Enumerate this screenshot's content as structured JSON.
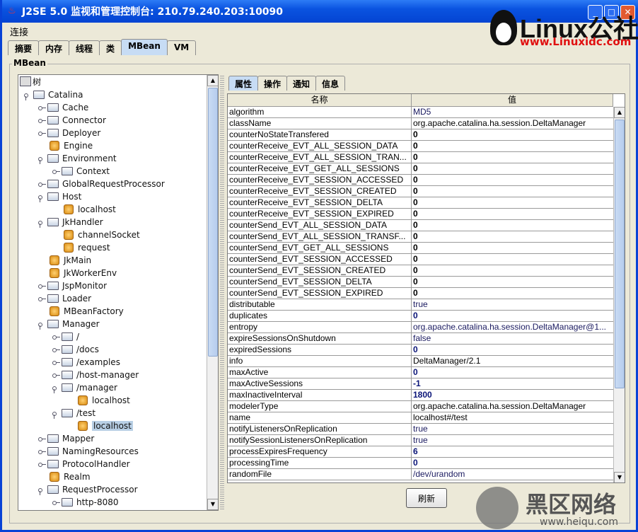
{
  "window": {
    "title": "J2SE 5.0 监视和管理控制台: 210.79.240.203:10090"
  },
  "menu": [
    "连接"
  ],
  "tabs": [
    {
      "label": "摘要"
    },
    {
      "label": "内存"
    },
    {
      "label": "线程"
    },
    {
      "label": "类"
    },
    {
      "label": "MBean",
      "active": true
    },
    {
      "label": "VM"
    }
  ],
  "group_label": "MBean",
  "tree": {
    "root": "树",
    "nodes": [
      {
        "label": "Catalina",
        "depth": 0,
        "type": "folder",
        "expanded": true
      },
      {
        "label": "Cache",
        "depth": 1,
        "type": "folder"
      },
      {
        "label": "Connector",
        "depth": 1,
        "type": "folder"
      },
      {
        "label": "Deployer",
        "depth": 1,
        "type": "folder"
      },
      {
        "label": "Engine",
        "depth": 1,
        "type": "bean"
      },
      {
        "label": "Environment",
        "depth": 1,
        "type": "folder",
        "expanded": true
      },
      {
        "label": "Context",
        "depth": 2,
        "type": "folder"
      },
      {
        "label": "GlobalRequestProcessor",
        "depth": 1,
        "type": "folder"
      },
      {
        "label": "Host",
        "depth": 1,
        "type": "folder",
        "expanded": true
      },
      {
        "label": "localhost",
        "depth": 2,
        "type": "bean"
      },
      {
        "label": "JkHandler",
        "depth": 1,
        "type": "folder",
        "expanded": true
      },
      {
        "label": "channelSocket",
        "depth": 2,
        "type": "bean"
      },
      {
        "label": "request",
        "depth": 2,
        "type": "bean"
      },
      {
        "label": "JkMain",
        "depth": 1,
        "type": "bean"
      },
      {
        "label": "JkWorkerEnv",
        "depth": 1,
        "type": "bean"
      },
      {
        "label": "JspMonitor",
        "depth": 1,
        "type": "folder"
      },
      {
        "label": "Loader",
        "depth": 1,
        "type": "folder"
      },
      {
        "label": "MBeanFactory",
        "depth": 1,
        "type": "bean"
      },
      {
        "label": "Manager",
        "depth": 1,
        "type": "folder",
        "expanded": true
      },
      {
        "label": "/",
        "depth": 2,
        "type": "folder"
      },
      {
        "label": "/docs",
        "depth": 2,
        "type": "folder"
      },
      {
        "label": "/examples",
        "depth": 2,
        "type": "folder"
      },
      {
        "label": "/host-manager",
        "depth": 2,
        "type": "folder"
      },
      {
        "label": "/manager",
        "depth": 2,
        "type": "folder",
        "expanded": true
      },
      {
        "label": "localhost",
        "depth": 3,
        "type": "bean"
      },
      {
        "label": "/test",
        "depth": 2,
        "type": "folder",
        "expanded": true
      },
      {
        "label": "localhost",
        "depth": 3,
        "type": "bean",
        "selected": true
      },
      {
        "label": "Mapper",
        "depth": 1,
        "type": "folder"
      },
      {
        "label": "NamingResources",
        "depth": 1,
        "type": "folder"
      },
      {
        "label": "ProtocolHandler",
        "depth": 1,
        "type": "folder"
      },
      {
        "label": "Realm",
        "depth": 1,
        "type": "bean"
      },
      {
        "label": "RequestProcessor",
        "depth": 1,
        "type": "folder",
        "expanded": true
      },
      {
        "label": "http-8080",
        "depth": 2,
        "type": "folder"
      }
    ]
  },
  "detail_tabs": [
    {
      "label": "属性",
      "active": true
    },
    {
      "label": "操作"
    },
    {
      "label": "通知"
    },
    {
      "label": "信息"
    }
  ],
  "table": {
    "headers": [
      "名称",
      "值"
    ],
    "rows": [
      {
        "name": "algorithm",
        "value": "MD5",
        "style": "edit"
      },
      {
        "name": "className",
        "value": "org.apache.catalina.ha.session.DeltaManager",
        "style": "text"
      },
      {
        "name": "counterNoStateTransfered",
        "value": "0",
        "style": "num"
      },
      {
        "name": "counterReceive_EVT_ALL_SESSION_DATA",
        "value": "0",
        "style": "num"
      },
      {
        "name": "counterReceive_EVT_ALL_SESSION_TRAN...",
        "value": "0",
        "style": "num"
      },
      {
        "name": "counterReceive_EVT_GET_ALL_SESSIONS",
        "value": "0",
        "style": "num"
      },
      {
        "name": "counterReceive_EVT_SESSION_ACCESSED",
        "value": "0",
        "style": "num"
      },
      {
        "name": "counterReceive_EVT_SESSION_CREATED",
        "value": "0",
        "style": "num"
      },
      {
        "name": "counterReceive_EVT_SESSION_DELTA",
        "value": "0",
        "style": "num"
      },
      {
        "name": "counterReceive_EVT_SESSION_EXPIRED",
        "value": "0",
        "style": "num"
      },
      {
        "name": "counterSend_EVT_ALL_SESSION_DATA",
        "value": "0",
        "style": "num"
      },
      {
        "name": "counterSend_EVT_ALL_SESSION_TRANSF...",
        "value": "0",
        "style": "num"
      },
      {
        "name": "counterSend_EVT_GET_ALL_SESSIONS",
        "value": "0",
        "style": "num"
      },
      {
        "name": "counterSend_EVT_SESSION_ACCESSED",
        "value": "0",
        "style": "num"
      },
      {
        "name": "counterSend_EVT_SESSION_CREATED",
        "value": "0",
        "style": "num"
      },
      {
        "name": "counterSend_EVT_SESSION_DELTA",
        "value": "0",
        "style": "num"
      },
      {
        "name": "counterSend_EVT_SESSION_EXPIRED",
        "value": "0",
        "style": "num"
      },
      {
        "name": "distributable",
        "value": "true",
        "style": "edit"
      },
      {
        "name": "duplicates",
        "value": "0",
        "style": "numblue"
      },
      {
        "name": "entropy",
        "value": "org.apache.catalina.ha.session.DeltaManager@1...",
        "style": "edit"
      },
      {
        "name": "expireSessionsOnShutdown",
        "value": "false",
        "style": "edit"
      },
      {
        "name": "expiredSessions",
        "value": "0",
        "style": "numblue"
      },
      {
        "name": "info",
        "value": "DeltaManager/2.1",
        "style": "text"
      },
      {
        "name": "maxActive",
        "value": "0",
        "style": "numblue"
      },
      {
        "name": "maxActiveSessions",
        "value": "-1",
        "style": "numblue"
      },
      {
        "name": "maxInactiveInterval",
        "value": "1800",
        "style": "numblue"
      },
      {
        "name": "modelerType",
        "value": "org.apache.catalina.ha.session.DeltaManager",
        "style": "text"
      },
      {
        "name": "name",
        "value": "localhost#/test",
        "style": "text"
      },
      {
        "name": "notifyListenersOnReplication",
        "value": "true",
        "style": "edit"
      },
      {
        "name": "notifySessionListenersOnReplication",
        "value": "true",
        "style": "edit"
      },
      {
        "name": "processExpiresFrequency",
        "value": "6",
        "style": "numblue"
      },
      {
        "name": "processingTime",
        "value": "0",
        "style": "numblue"
      },
      {
        "name": "randomFile",
        "value": "/dev/urandom",
        "style": "edit"
      }
    ]
  },
  "refresh_label": "刷新",
  "watermarks": {
    "top": {
      "brand": "Linux公社",
      "url": "www.Linuxidc.com"
    },
    "bottom": {
      "brand": "黑区网络",
      "url": "www.heiqu.com"
    }
  }
}
